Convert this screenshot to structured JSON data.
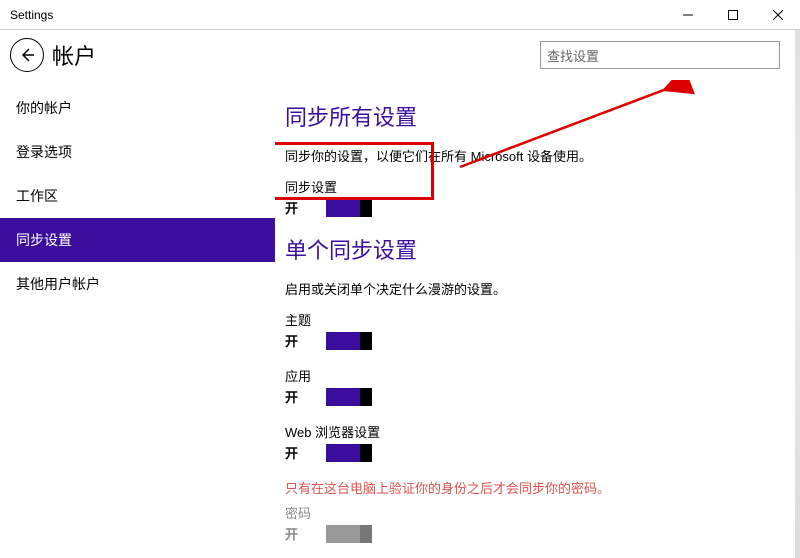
{
  "titlebar": {
    "title": "Settings"
  },
  "header": {
    "title": "帐户"
  },
  "search": {
    "placeholder": "查找设置"
  },
  "sidebar": {
    "items": [
      {
        "label": "你的帐户"
      },
      {
        "label": "登录选项"
      },
      {
        "label": "工作区"
      },
      {
        "label": "同步设置"
      },
      {
        "label": "其他用户帐户"
      }
    ],
    "activeIndex": 3
  },
  "content": {
    "section1": {
      "heading": "同步所有设置",
      "desc": "同步你的设置，以便它们在所有 Microsoft 设备使用。",
      "syncSettings": {
        "label": "同步设置",
        "state": "开"
      }
    },
    "section2": {
      "heading": "单个同步设置",
      "desc": "启用或关闭单个决定什么漫游的设置。",
      "theme": {
        "label": "主题",
        "state": "开"
      },
      "apps": {
        "label": "应用",
        "state": "开"
      },
      "web": {
        "label": "Web 浏览器设置",
        "state": "开"
      },
      "warn": "只有在这台电脑上验证你的身份之后才会同步你的密码。",
      "password": {
        "label": "密码",
        "state": "开"
      }
    }
  }
}
